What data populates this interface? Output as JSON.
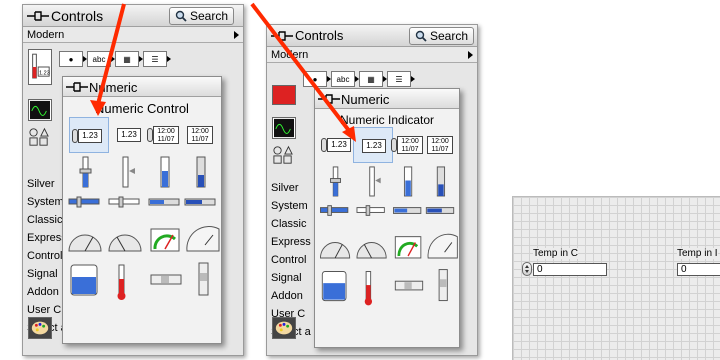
{
  "palette_left": {
    "title": "Controls",
    "search_label": "Search",
    "modern_label": "Modern",
    "categories": [
      "Silver",
      "System",
      "Classic",
      "Express",
      "Control",
      "Signal",
      "Addon",
      "User C",
      "Select a"
    ]
  },
  "subpalette_left": {
    "title": "Numeric",
    "heading": "Numeric Control",
    "num_value": "1.23",
    "ts_value": "12:00 11/07"
  },
  "palette_right": {
    "title": "Controls",
    "search_label": "Search",
    "modern_label": "Modern",
    "categories": [
      "Silver",
      "System",
      "Classic",
      "Express",
      "Control",
      "Signal",
      "Addon",
      "User C",
      "Select a"
    ]
  },
  "subpalette_right": {
    "title": "Numeric",
    "heading": "Numeric Indicator",
    "num_value": "1.23",
    "ts_value": "12:00 11/07"
  },
  "front_panel": {
    "control_label": "Temp in C",
    "control_value": "0",
    "indicator_label": "Temp in I",
    "indicator_value": "0"
  },
  "colors": {
    "arrow": "#ff2a00",
    "selection": "#8fb3e0"
  }
}
